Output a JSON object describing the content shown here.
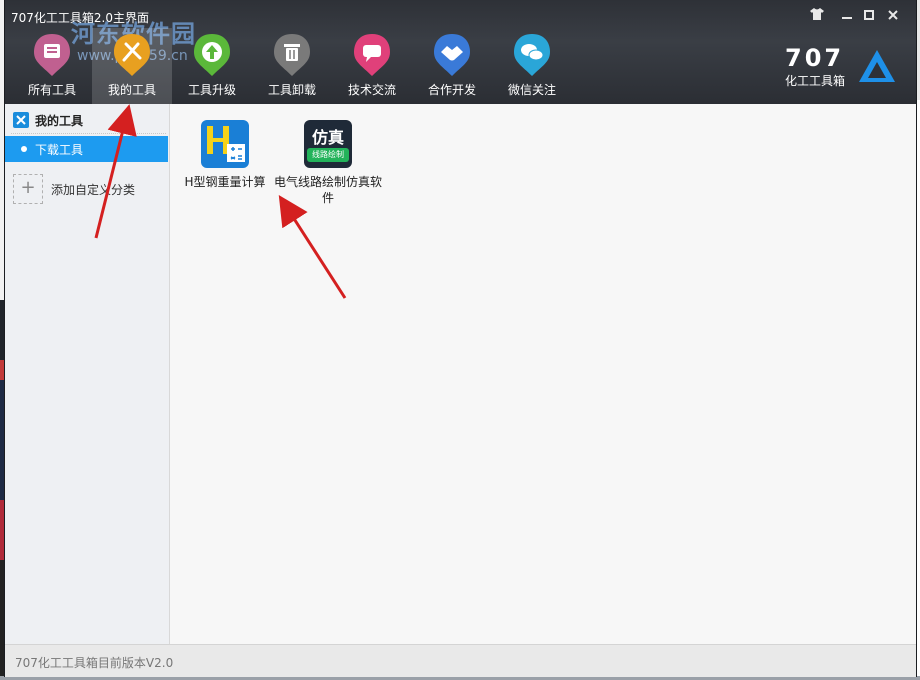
{
  "window": {
    "title": "707化工工具箱2.0主界面",
    "controls": [
      "shirt-icon",
      "minimize-icon",
      "maximize-icon",
      "close-icon"
    ]
  },
  "toolbar": {
    "items": [
      {
        "label": "所有工具",
        "icon": "all-tools-icon",
        "color": "#c06090",
        "active": false
      },
      {
        "label": "我的工具",
        "icon": "my-tools-icon",
        "color": "#e8a020",
        "active": true
      },
      {
        "label": "工具升级",
        "icon": "upgrade-icon",
        "color": "#5bb83a",
        "active": false
      },
      {
        "label": "工具卸载",
        "icon": "trash-icon",
        "color": "#7a7a7a",
        "active": false
      },
      {
        "label": "技术交流",
        "icon": "chat-icon",
        "color": "#e0407a",
        "active": false
      },
      {
        "label": "合作开发",
        "icon": "handshake-icon",
        "color": "#3a7ad8",
        "active": false
      },
      {
        "label": "微信关注",
        "icon": "wechat-icon",
        "color": "#2aa6d8",
        "active": false
      }
    ]
  },
  "logo": {
    "number": "707",
    "subtitle": "化工工具箱",
    "accent": "#1e90e8"
  },
  "watermark": {
    "text": "河东软件园",
    "url": "www.pc0359.cn"
  },
  "sidebar": {
    "header": "我的工具",
    "items": [
      {
        "label": "下载工具",
        "selected": true
      }
    ],
    "add_label": "添加自定义分类"
  },
  "main": {
    "apps": [
      {
        "label": "H型钢重量计算",
        "icon": "h-beam-calculator-icon"
      },
      {
        "label": "电气线路绘制仿真软件",
        "icon": "circuit-simulation-icon",
        "icon_text_top": "仿真",
        "icon_text_bottom": "线路绘制"
      }
    ]
  },
  "status": {
    "text": "707化工工具箱目前版本V2.0"
  },
  "colors": {
    "accent": "#1d9bf0",
    "header": "#33363c",
    "annotation": "#d42020"
  }
}
